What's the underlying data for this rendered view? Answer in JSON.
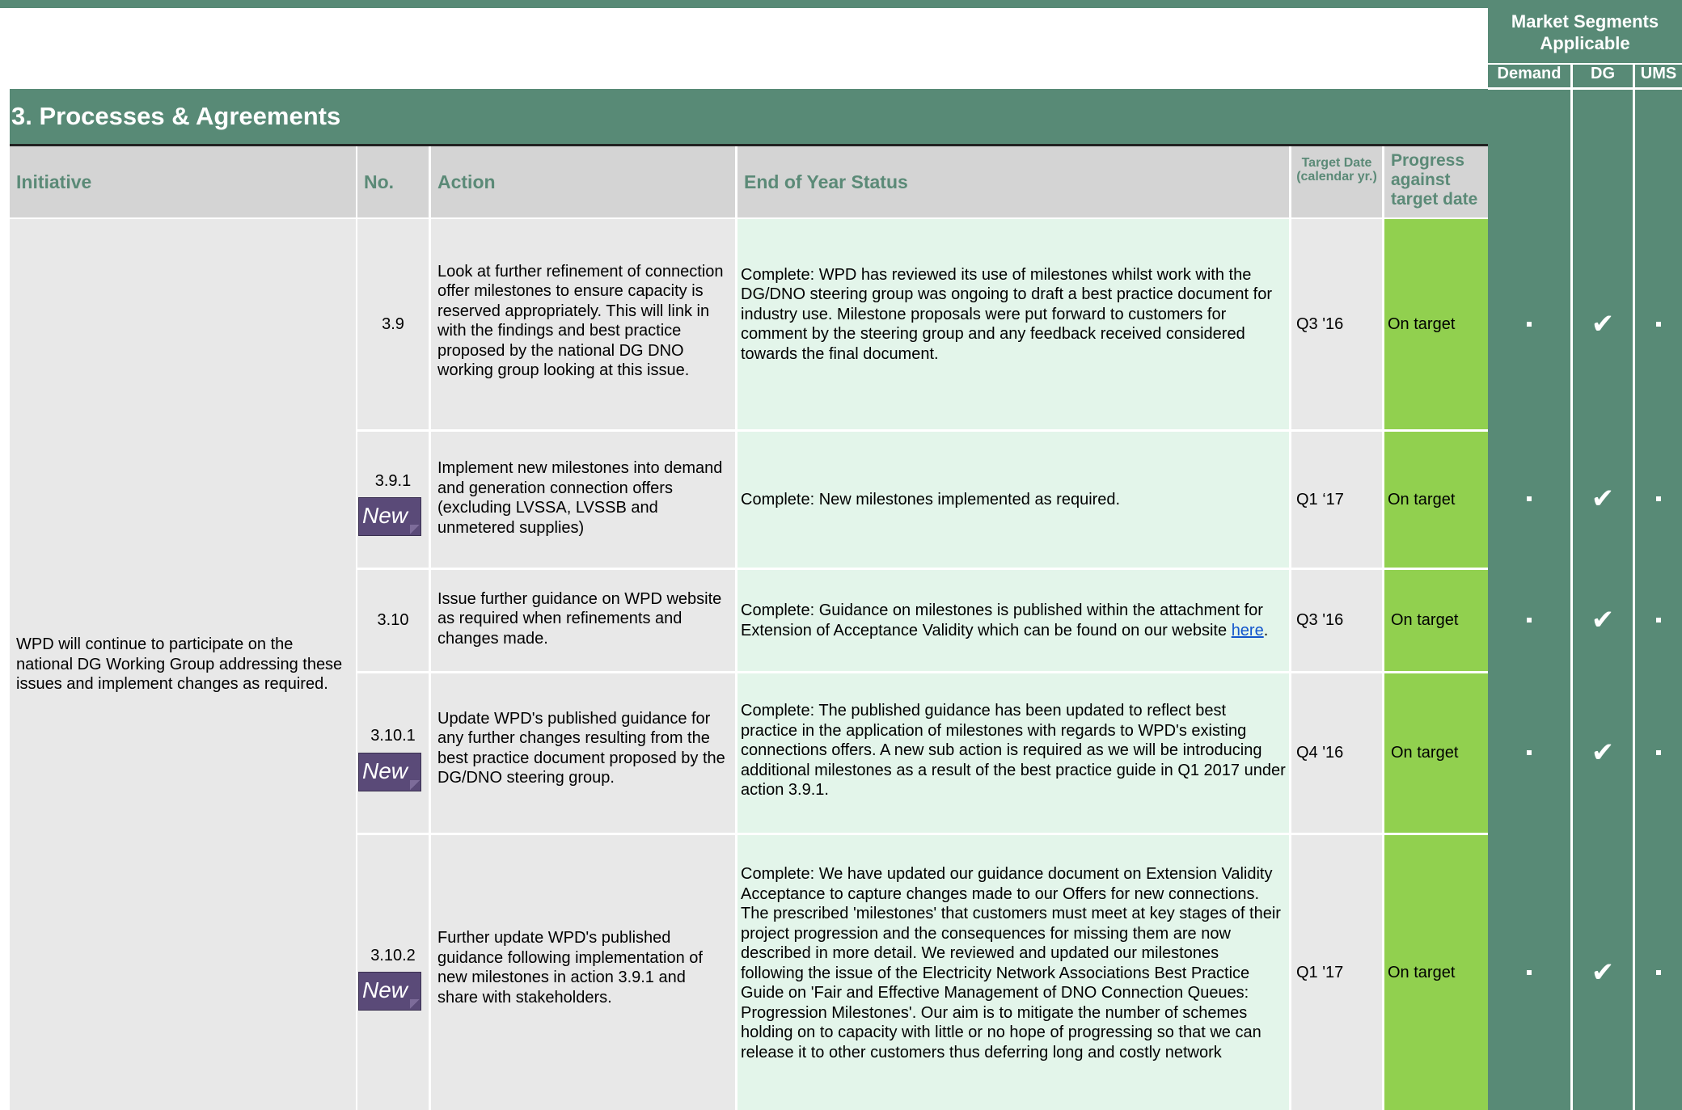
{
  "market_segments": {
    "title": "Market  Segments Applicable",
    "columns": [
      "Demand",
      "DG",
      "UMS"
    ]
  },
  "section": {
    "title": "3. Processes & Agreements"
  },
  "headers": {
    "initiative": "Initiative",
    "no": "No.",
    "action": "Action",
    "status": "End of Year Status",
    "target_date": "Target Date (calendar yr.)",
    "progress": "Progress against target date"
  },
  "initiative_text": "WPD will continue to participate on the national DG Working Group addressing these issues and implement changes as required.",
  "badge_label": "New",
  "rows": [
    {
      "no": "3.9",
      "new": false,
      "action": "Look at further refinement of connection offer milestones to ensure capacity is reserved appropriately. This will link in with the findings and best practice proposed by the national DG DNO working group looking at this issue.",
      "status": "Complete: WPD has reviewed its use of milestones whilst work with the DG/DNO steering group was ongoing to draft a best practice document for industry use.  Milestone proposals were put forward to customers for comment by the steering group and any feedback received considered towards the final document.",
      "target": "Q3 '16",
      "progress": "On target",
      "segments": [
        "dot",
        "tick",
        "dot"
      ]
    },
    {
      "no": "3.9.1",
      "new": true,
      "action": "Implement new milestones into demand and generation connection offers (excluding LVSSA, LVSSB and unmetered supplies)",
      "status": "Complete: New milestones implemented as required.",
      "target": "Q1 ‘17",
      "progress": "On target",
      "segments": [
        "dot",
        "tick",
        "dot"
      ]
    },
    {
      "no": "3.10",
      "new": false,
      "action": "Issue further guidance on WPD website  as required  when refinements and changes made.",
      "status": "Complete: Guidance on milestones is published within the attachment for Extension of Acceptance Validity which can be found on our website",
      "status_link": "here",
      "status_tail": ".",
      "target": "Q3 '16",
      "progress": "On target",
      "segments": [
        "dot",
        "tick",
        "dot"
      ]
    },
    {
      "no": "3.10.1",
      "new": true,
      "action": "Update WPD's published guidance for any further changes resulting from the best practice document proposed by the DG/DNO steering group.",
      "status": "Complete: The published guidance has been updated to reflect best practice in the application of milestones with regards to WPD's existing connections offers.  A new sub action is required as we will be introducing additional milestones as a result of the best practice guide in Q1 2017 under action 3.9.1.",
      "target": "Q4 '16",
      "progress": "On target",
      "segments": [
        "dot",
        "tick",
        "dot"
      ]
    },
    {
      "no": "3.10.2",
      "new": true,
      "action": "Further update WPD's published guidance following implementation of new milestones in action 3.9.1 and share with stakeholders.",
      "status": "Complete: We have updated our guidance document on Extension Validity Acceptance to capture changes made to our Offers for new connections. The prescribed 'milestones' that customers must meet at key stages of their project progression and the consequences for missing them are now described in more detail. We reviewed and updated our milestones following the issue of the Electricity Network Associations  Best Practice Guide on 'Fair and Effective Management of DNO Connection Queues: Progression Milestones'. Our aim is to mitigate the number of schemes holding on to capacity with little or no hope of progressing so that we can release it to other customers thus deferring long and costly network",
      "target": "Q1 '17",
      "progress": "On target",
      "segments": [
        "dot",
        "tick",
        "dot"
      ]
    }
  ]
}
